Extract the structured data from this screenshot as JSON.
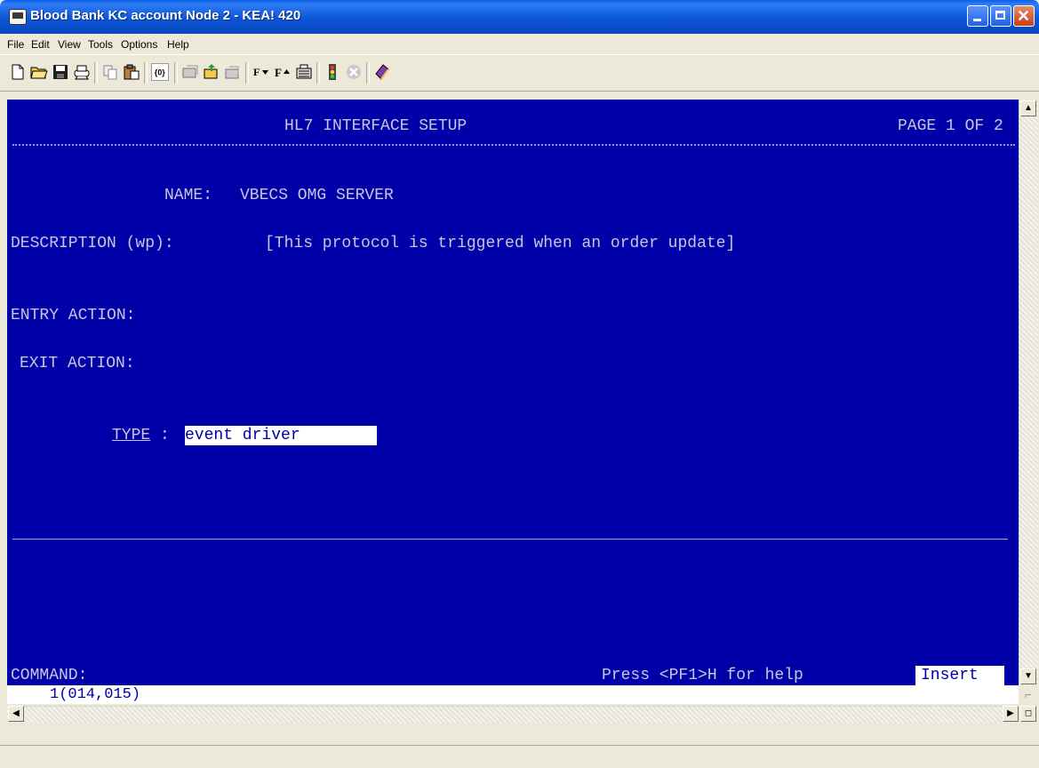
{
  "window": {
    "title": "Blood Bank KC account Node 2 - KEA! 420",
    "colors": {
      "titlebar": "#0a55d6",
      "terminal_bg": "#0000a8",
      "terminal_fg": "#c6c6e8",
      "field_bg": "#ffffff"
    }
  },
  "menu": [
    "File",
    "Edit",
    "View",
    "Tools",
    "Options",
    "Help"
  ],
  "toolbar": {
    "icons": [
      "new-file-icon",
      "open-folder-icon",
      "save-icon",
      "print-icon",
      "copy-icon",
      "paste-icon",
      "capture-icon",
      "session-icon",
      "send-file-icon",
      "receive-file-icon",
      "font-smaller-icon",
      "font-larger-icon",
      "keyboard-icon",
      "traffic-light-icon",
      "disconnect-icon",
      "help-book-icon"
    ]
  },
  "screen": {
    "header_title": "HL7 INTERFACE SETUP",
    "page_indicator": "PAGE 1 OF 2",
    "name_label": "NAME:",
    "name_value": "VBECS OMG SERVER",
    "description_label": "DESCRIPTION (wp):",
    "description_value": "[This protocol is triggered when an order update]",
    "entry_action_label": "ENTRY ACTION:",
    "exit_action_label": "EXIT ACTION:",
    "type_label": "TYPE",
    "type_colon": ":",
    "type_value": "event driver",
    "command_label": "COMMAND:",
    "help_hint": "Press <PF1>H for help",
    "mode": "Insert"
  },
  "status": {
    "cursor_position": "1(014,015)"
  }
}
